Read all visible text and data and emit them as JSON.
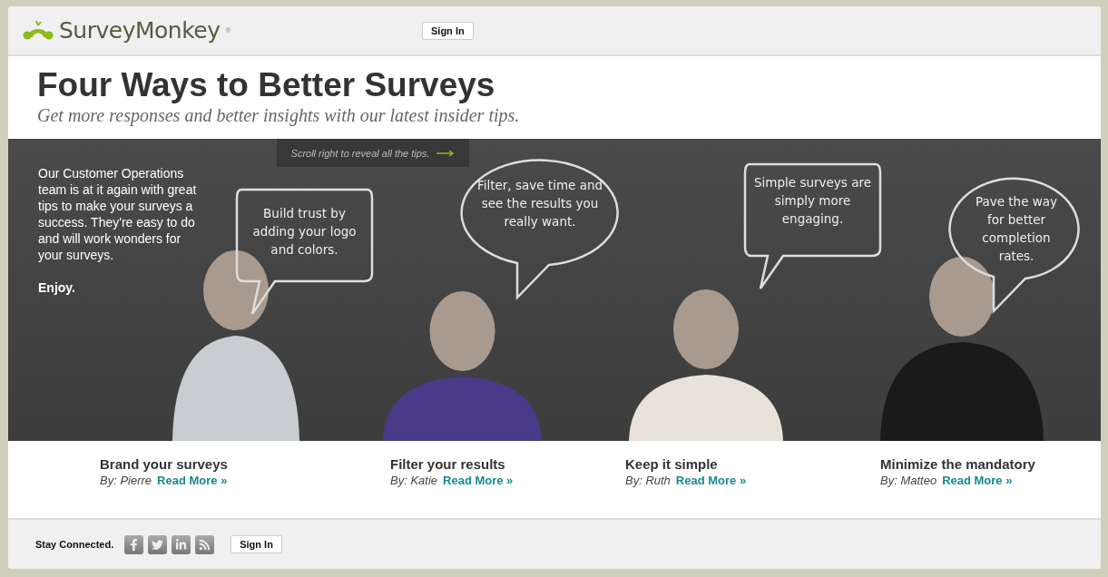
{
  "header": {
    "logo": "SurveyMonkey",
    "registered": "®",
    "sign_in": "Sign In"
  },
  "hero": {
    "title": "Four Ways to Better Surveys",
    "subtitle": "Get more responses and better insights with our latest insider tips."
  },
  "banner": {
    "scroll_hint": "Scroll right to reveal all the tips.",
    "intro": "Our Customer Operations team is at it again with great tips to make your surveys a success. They're easy to do and will work wonders for your surveys.",
    "sign_off": "Enjoy."
  },
  "tips": [
    {
      "bubble": "Build trust by adding your logo and colors.",
      "kind": "box",
      "title": "Brand your surveys",
      "author": "By: Pierre",
      "link": "Read More »"
    },
    {
      "bubble": "Filter, save time and see the results you really want.",
      "kind": "oval",
      "title": "Filter your results",
      "author": "By: Katie",
      "link": "Read More »"
    },
    {
      "bubble": "Simple surveys are simply more engaging.",
      "kind": "box",
      "title": "Keep it simple",
      "author": "By: Ruth",
      "link": "Read More »"
    },
    {
      "bubble": "Pave the way for better completion rates.",
      "kind": "oval",
      "title": "Minimize the mandatory",
      "author": "By: Matteo",
      "link": "Read More »"
    }
  ],
  "footer": {
    "label": "Stay Connected.",
    "sign_in": "Sign In"
  }
}
